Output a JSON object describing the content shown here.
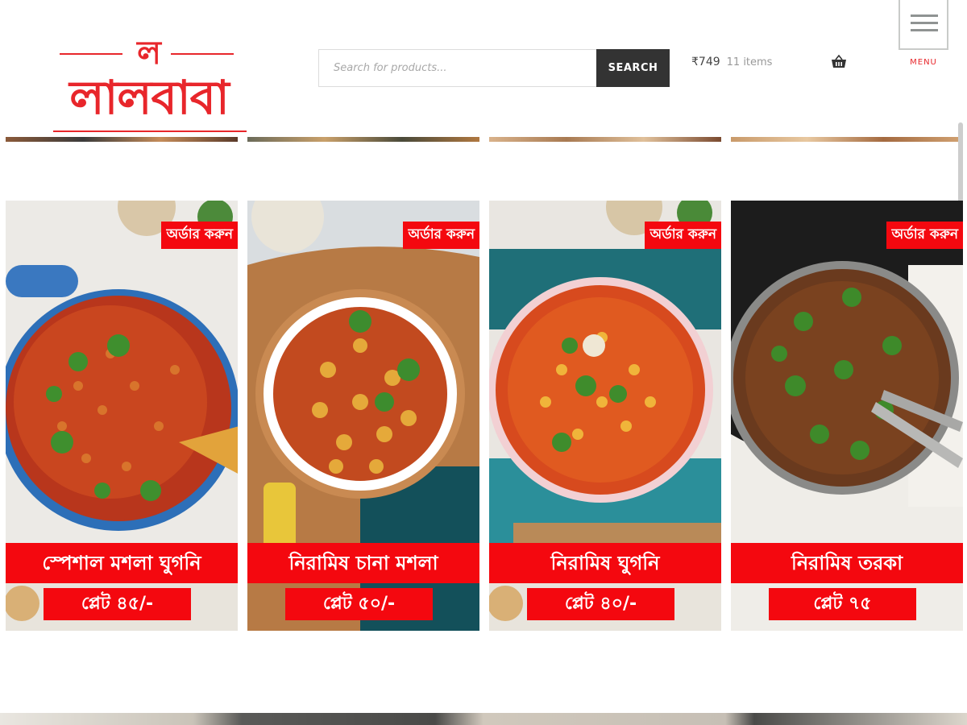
{
  "logo": {
    "small": "ল",
    "main": "লালবাবা"
  },
  "search": {
    "placeholder": "Search for products...",
    "button": "SEARCH"
  },
  "cart": {
    "amount": "₹749",
    "count": "11 items"
  },
  "menu": {
    "label": "MENU"
  },
  "products": [
    {
      "order": "অর্ডার করুন",
      "name": "স্পেশাল মশলা ঘুগনি",
      "price": "প্লেট ৪৫/-"
    },
    {
      "order": "অর্ডার করুন",
      "name": "নিরামিষ চানা মশলা",
      "price": "প্লেট ৫০/-"
    },
    {
      "order": "অর্ডার করুন",
      "name": "নিরামিষ ঘুগনি",
      "price": "প্লেট ৪০/-"
    },
    {
      "order": "অর্ডার করুন",
      "name": "নিরামিষ তরকা",
      "price": "প্লেট ৭৫"
    }
  ],
  "colors": {
    "accent": "#f4080f",
    "brand": "#e8262b",
    "search_button": "#333333"
  },
  "icons": [
    "basket-icon",
    "hamburger-menu-icon"
  ]
}
